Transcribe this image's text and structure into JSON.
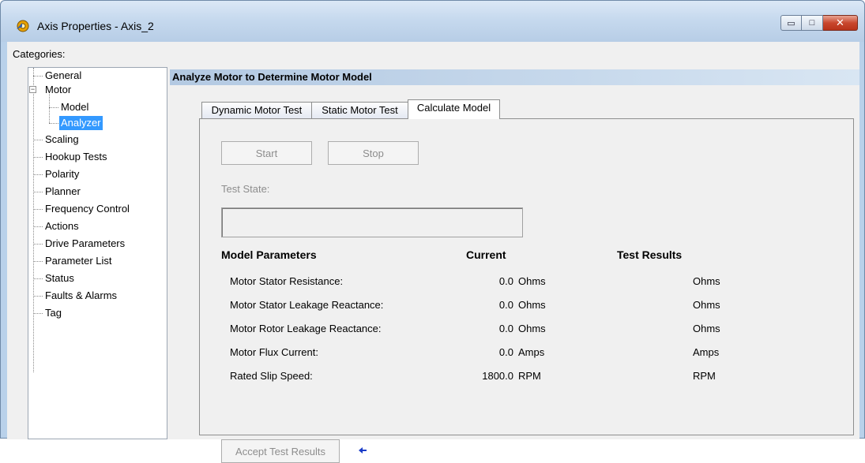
{
  "window": {
    "title": "Axis Properties - Axis_2",
    "min_glyph": "▭",
    "max_glyph": "□",
    "close_glyph": "✕"
  },
  "categories_label": "Categories:",
  "tree": {
    "items": [
      {
        "label": "General"
      },
      {
        "label": "Motor",
        "expander": "−"
      },
      {
        "label": "Model"
      },
      {
        "label": "Analyzer",
        "selected": true
      },
      {
        "label": "Scaling"
      },
      {
        "label": "Hookup Tests"
      },
      {
        "label": "Polarity"
      },
      {
        "label": "Planner"
      },
      {
        "label": "Frequency Control"
      },
      {
        "label": "Actions"
      },
      {
        "label": "Drive Parameters"
      },
      {
        "label": "Parameter List"
      },
      {
        "label": "Status"
      },
      {
        "label": "Faults & Alarms"
      },
      {
        "label": "Tag"
      }
    ]
  },
  "section_header": "Analyze Motor to Determine Motor Model",
  "tabs": [
    {
      "label": "Dynamic Motor Test",
      "active": false
    },
    {
      "label": "Static Motor Test",
      "active": false
    },
    {
      "label": "Calculate Model",
      "active": true
    }
  ],
  "panel": {
    "start_label": "Start",
    "stop_label": "Stop",
    "test_state_label": "Test State:",
    "test_state_value": "",
    "col_parameters": "Model Parameters",
    "col_current": "Current",
    "col_results": "Test Results",
    "rows": [
      {
        "name": "Motor Stator Resistance:",
        "value": "0.0",
        "unit": "Ohms",
        "result_unit": "Ohms"
      },
      {
        "name": "Motor Stator Leakage Reactance:",
        "value": "0.0",
        "unit": "Ohms",
        "result_unit": "Ohms"
      },
      {
        "name": "Motor Rotor Leakage Reactance:",
        "value": "0.0",
        "unit": "Ohms",
        "result_unit": "Ohms"
      },
      {
        "name": "Motor Flux Current:",
        "value": "0.0",
        "unit": "Amps",
        "result_unit": "Amps"
      },
      {
        "name": "Rated Slip Speed:",
        "value": "1800.0",
        "unit": "RPM",
        "result_unit": "RPM"
      }
    ],
    "accept_label": "Accept Test Results",
    "arrow_glyph": "🡐"
  },
  "colors": {
    "selected_bg": "#3399ff",
    "header_gradient": "#b3c9e2",
    "close_red": "#c9472e"
  }
}
